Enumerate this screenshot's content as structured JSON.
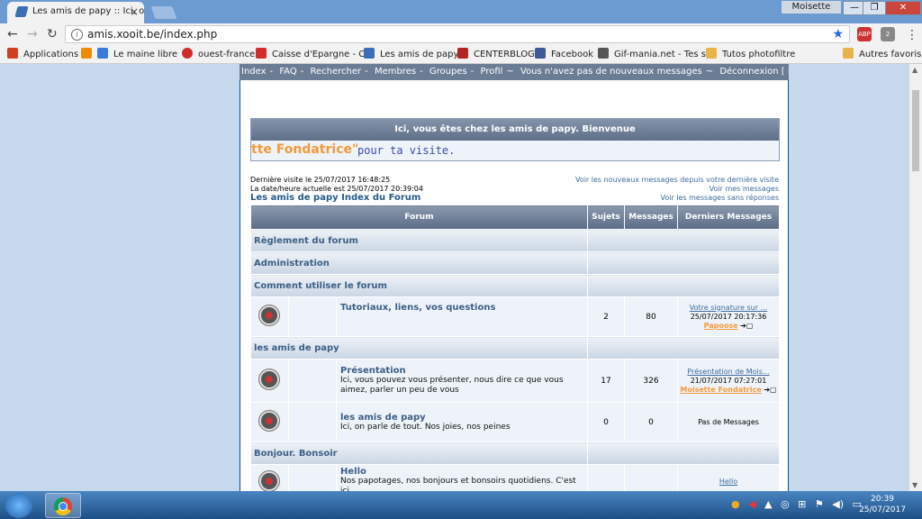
{
  "browser": {
    "tab_title": "Les amis de papy :: Ici, on",
    "tab_close": "×",
    "profile_name": "Moisette",
    "window_min": "—",
    "window_max": "❐",
    "window_close": "✕",
    "url": "amis.xooit.be/index.php",
    "ext1_badge": "ABP",
    "ext2_badge": "2"
  },
  "bookmarks": [
    {
      "label": "Applications",
      "color": "#d04020"
    },
    {
      "label": "Le maine libre",
      "color": "#3a7bd5"
    },
    {
      "label": "ouest-france",
      "color": "#d02a2a"
    },
    {
      "label": "Caisse d'Epargne - Ca",
      "color": "#d12c2c"
    },
    {
      "label": "Les amis de papy",
      "color": "#3a6fb5"
    },
    {
      "label": "CENTERBLOG",
      "color": "#b32424"
    },
    {
      "label": "Facebook",
      "color": "#3b5998"
    },
    {
      "label": "Gif-mania.net - Tes si",
      "color": "#555555"
    },
    {
      "label": "Tutos photofiltre",
      "color": "#e8b44a"
    },
    {
      "label": "Autres favoris",
      "color": "#e8b44a"
    }
  ],
  "nav": {
    "links": [
      "Index",
      "FAQ",
      "Rechercher",
      "Membres",
      "Groupes",
      "Profil",
      "Vous n'avez pas de nouveaux messages",
      "Déconnexion [ Moisette Fondatrice"
    ],
    "separators": [
      "-",
      "-",
      "-",
      "-",
      "-",
      "~",
      "~"
    ]
  },
  "welcome": {
    "title": "Ici, vous êtes chez les amis de papy. Bienvenue",
    "name_scroll": "tte Fondatrice\"",
    "thanks": "pour ta visite."
  },
  "info": {
    "last_visit": "Dernière visite le 25/07/2017 16:48:25",
    "current_time": "La date/heure actuelle est 25/07/2017 20:39:04",
    "forum_index": "Les amis de papy Index du Forum",
    "new_since": "Voir les nouveaux messages depuis votre dernière visite",
    "my_messages": "Voir mes messages",
    "unanswered": "Voir les messages sans réponses"
  },
  "table": {
    "headers": [
      "Forum",
      "Sujets",
      "Messages",
      "Derniers Messages"
    ],
    "categories": [
      {
        "name": "Règlement du forum"
      },
      {
        "name": "Administration"
      },
      {
        "name": "Comment utiliser le forum"
      },
      {
        "name": "les amis de papy"
      },
      {
        "name": "Bonjour. Bonsoir"
      }
    ],
    "forums": [
      {
        "name": "Tutoriaux, liens, vos questions",
        "desc": "",
        "topics": "2",
        "posts": "80",
        "last_title": "Votre signature sur ...",
        "last_date": "25/07/2017 20:17:36",
        "last_user": "Papoose"
      },
      {
        "name": "Présentation",
        "desc": "Ici, vous pouvez vous présenter, nous dire ce que vous aimez, parler un peu de vous",
        "topics": "17",
        "posts": "326",
        "last_title": "Présentation de Mois...",
        "last_date": "21/07/2017 07:27:01",
        "last_user": "Moisette Fondatrice"
      },
      {
        "name": "les amis de papy",
        "desc": "Ici, on parle de tout. Nos joies, nos peines",
        "topics": "0",
        "posts": "0",
        "last_title": "Pas de Messages",
        "last_date": "",
        "last_user": ""
      },
      {
        "name": "Hello",
        "desc": "Nos papotages, nos bonjours et bonsoirs quotidiens. C'est ici",
        "topics": "",
        "posts": "",
        "last_title": "Hello",
        "last_date": "",
        "last_user": ""
      }
    ],
    "arrow_glyph": "➔▢"
  },
  "taskbar": {
    "time": "20:39",
    "date": "25/07/2017"
  }
}
